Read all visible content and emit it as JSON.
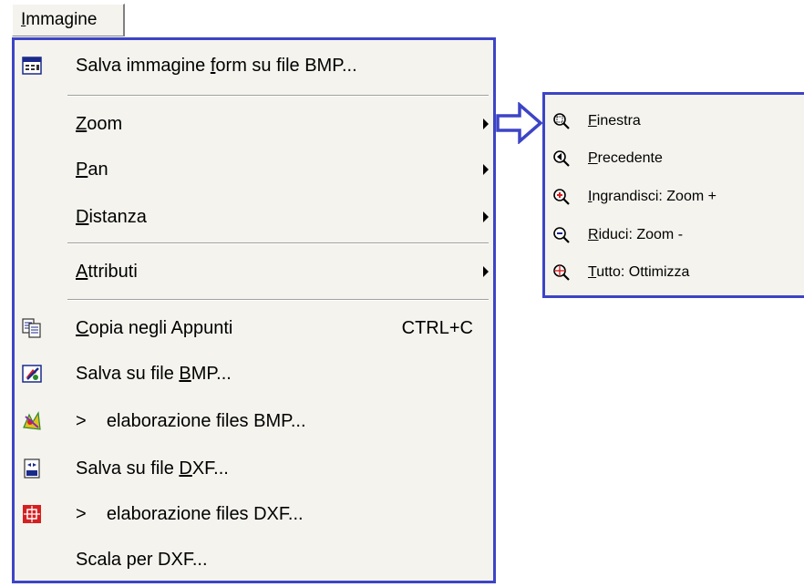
{
  "menubar": {
    "title_acc": "I",
    "title_rest": "mmagine"
  },
  "menu": {
    "items": [
      {
        "pre": "Salva immagine ",
        "acc": "f",
        "post": "orm su file BMP...",
        "shortcut": "",
        "icon": "form-save-icon"
      },
      {
        "pre": "",
        "acc": "Z",
        "post": "oom",
        "shortcut": "",
        "icon": ""
      },
      {
        "pre": "",
        "acc": "P",
        "post": "an",
        "shortcut": "",
        "icon": ""
      },
      {
        "pre": "",
        "acc": "D",
        "post": "istanza",
        "shortcut": "",
        "icon": ""
      },
      {
        "pre": "",
        "acc": "A",
        "post": "ttributi",
        "shortcut": "",
        "icon": ""
      },
      {
        "pre": "",
        "acc": "C",
        "post": "opia negli Appunti",
        "shortcut": "CTRL+C",
        "icon": "copy-icon"
      },
      {
        "pre": "Salva su file ",
        "acc": "B",
        "post": "MP...",
        "shortcut": "",
        "icon": "save-bmp-icon"
      },
      {
        "pre": ">    elaborazione files BMP...",
        "acc": "",
        "post": "",
        "shortcut": "",
        "icon": "process-bmp-icon"
      },
      {
        "pre": "Salva su file ",
        "acc": "D",
        "post": "XF...",
        "shortcut": "",
        "icon": "save-dxf-icon"
      },
      {
        "pre": ">    elaborazione files DXF...",
        "acc": "",
        "post": "",
        "shortcut": "",
        "icon": "process-dxf-icon"
      },
      {
        "pre": "Scala per DXF...",
        "acc": "",
        "post": "",
        "shortcut": "",
        "icon": ""
      }
    ]
  },
  "submenu": {
    "items": [
      {
        "acc": "F",
        "rest": "inestra",
        "icon": "zoom-window-icon"
      },
      {
        "acc": "P",
        "rest": "recedente",
        "icon": "zoom-previous-icon"
      },
      {
        "acc": "I",
        "rest": "ngrandisci: Zoom +",
        "icon": "zoom-in-icon"
      },
      {
        "acc": "R",
        "rest": "iduci: Zoom -",
        "icon": "zoom-out-icon"
      },
      {
        "acc": "T",
        "rest": "utto: Ottimizza",
        "icon": "zoom-all-icon"
      }
    ]
  },
  "colors": {
    "highlight_border": "#3d44c6",
    "menu_bg": "#f4f3ee"
  }
}
